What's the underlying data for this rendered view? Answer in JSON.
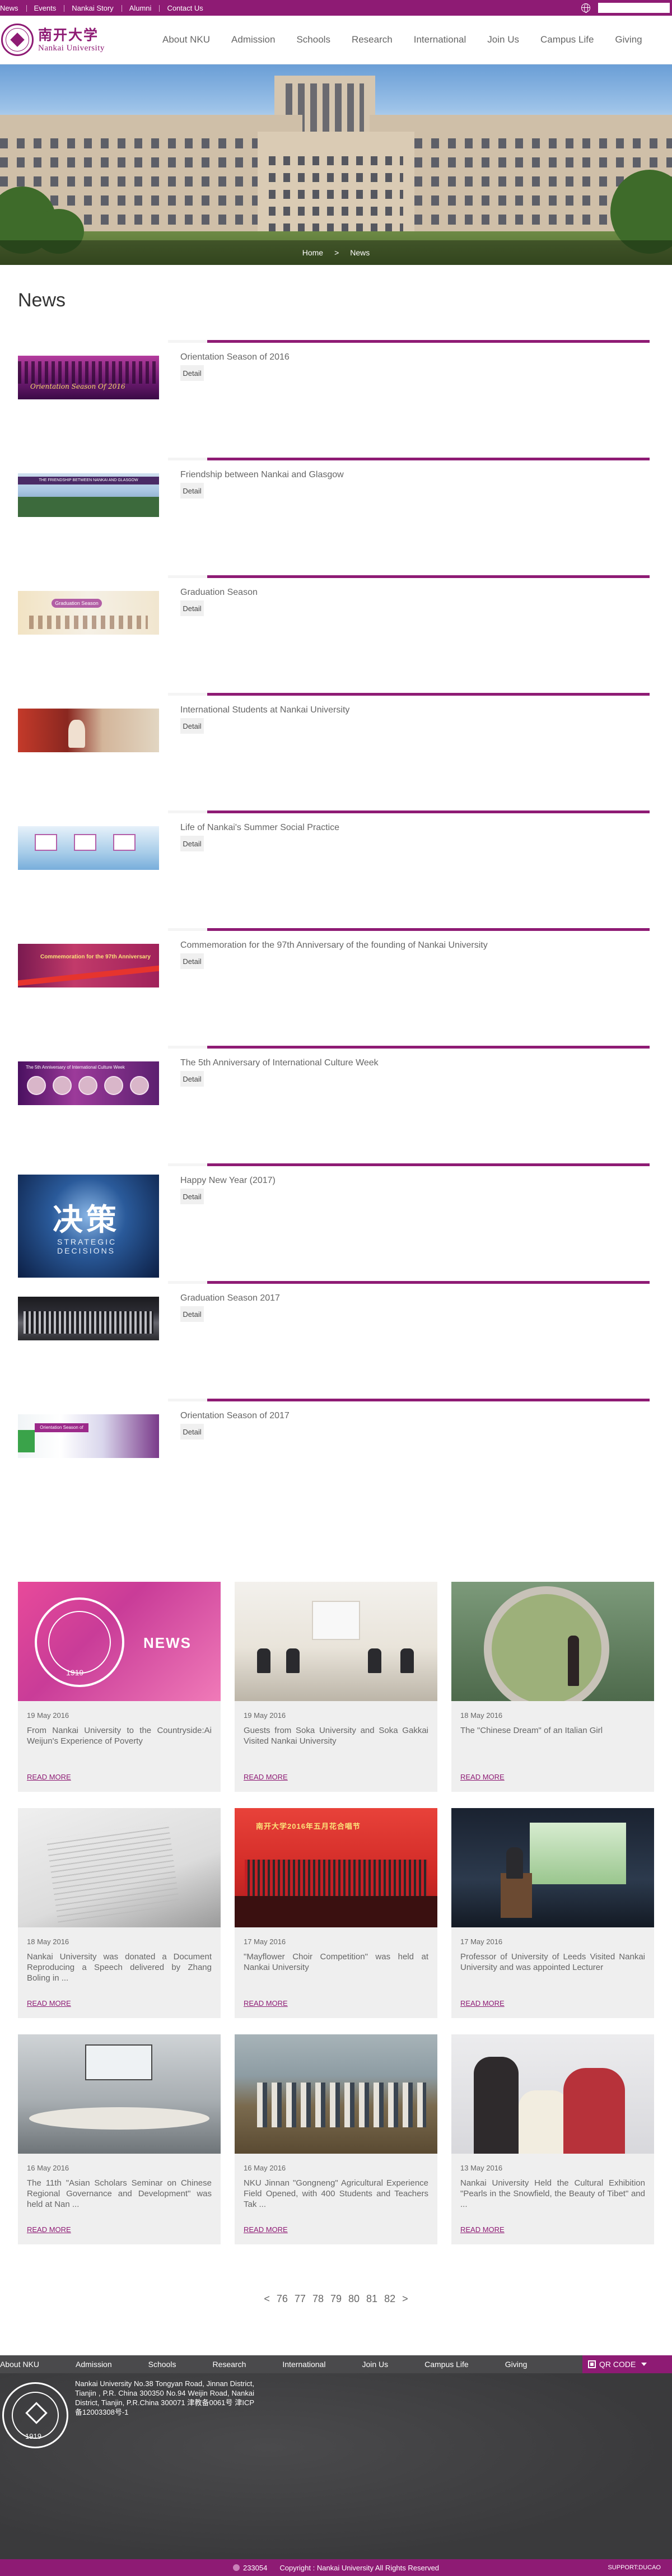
{
  "topbar": {
    "links": [
      "News",
      "Events",
      "Nankai Story",
      "Alumni",
      "Contact Us"
    ],
    "search_placeholder": ""
  },
  "header": {
    "logo_cn": "南开大学",
    "logo_en": "Nankai University",
    "nav": [
      "About NKU",
      "Admission",
      "Schools",
      "Research",
      "International",
      "Join Us",
      "Campus Life",
      "Giving"
    ]
  },
  "breadcrumb": {
    "home": "Home",
    "sep": ">",
    "current": "News"
  },
  "page_title": "News",
  "news_list": [
    {
      "title": "Orientation Season of 2016",
      "detail": "Detail",
      "thumb_text": "Orientation Season Of 2016"
    },
    {
      "title": "Friendship between Nankai and Glasgow",
      "detail": "Detail",
      "thumb_text": "THE FRIENDSHIP BETWEEN NANKAI AND GLASGOW"
    },
    {
      "title": "Graduation Season",
      "detail": "Detail",
      "thumb_text": "Graduation Season"
    },
    {
      "title": "International Students at Nankai University",
      "detail": "Detail"
    },
    {
      "title": "Life of Nankai's Summer Social Practice",
      "detail": "Detail"
    },
    {
      "title": "Commemoration for the 97th Anniversary of the founding of Nankai University",
      "detail": "Detail",
      "thumb_text": "Commemoration for the 97th Anniversary"
    },
    {
      "title": "The 5th Anniversary of International Culture Week",
      "detail": "Detail",
      "thumb_text": "The 5th Anniversary of International Culture Week"
    },
    {
      "title": "Happy New Year (2017)",
      "detail": "Detail",
      "thumb_cn": "决策",
      "thumb_en": "STRATEGIC DECISIONS"
    },
    {
      "title": "Graduation Season 2017",
      "detail": "Detail"
    },
    {
      "title": "Orientation Season of 2017",
      "detail": "Detail",
      "thumb_text": "Orientation Season of 2017"
    }
  ],
  "cards": [
    {
      "date": "19 May 2016",
      "title": "From Nankai University to the Countryside:Ai Weijun's Experience of Poverty",
      "read": "READ MORE",
      "img_word": "NEWS",
      "img_year": "1919"
    },
    {
      "date": "19 May 2016",
      "title": "Guests from Soka University and Soka Gakkai Visited Nankai University",
      "read": "READ MORE"
    },
    {
      "date": "18 May 2016",
      "title": "The \"Chinese Dream\" of an Italian Girl",
      "read": "READ MORE"
    },
    {
      "date": "18 May 2016",
      "title": "Nankai University was donated a Document Reproducing a Speech delivered by Zhang Boling in ...",
      "read": "READ MORE"
    },
    {
      "date": "17 May 2016",
      "title": "\"Mayflower Choir Competition\" was held at Nankai University",
      "read": "READ MORE",
      "img_text": "南开大学2016年五月花合唱节"
    },
    {
      "date": "17 May 2016",
      "title": "Professor of University of Leeds Visited Nankai University and was appointed Lecturer",
      "read": "READ MORE"
    },
    {
      "date": "16 May 2016",
      "title": "The 11th \"Asian Scholars Seminar on Chinese Regional Governance and Development\" was held at Nan ...",
      "read": "READ MORE"
    },
    {
      "date": "16 May 2016",
      "title": "NKU Jinnan \"Gongneng\" Agricultural Experience Field Opened, with 400 Students and Teachers Tak ...",
      "read": "READ MORE"
    },
    {
      "date": "13 May 2016",
      "title": "Nankai University Held the Cultural Exhibition \"Pearls in the Snowfield, the Beauty of Tibet\" and ...",
      "read": "READ MORE"
    }
  ],
  "pagination": {
    "prev": "<",
    "pages": [
      "76",
      "77",
      "78",
      "79",
      "80",
      "81",
      "82"
    ],
    "next": ">"
  },
  "footer": {
    "nav": [
      "About NKU",
      "Admission",
      "Schools",
      "Research",
      "International",
      "Join Us",
      "Campus Life",
      "Giving"
    ],
    "qr_label": "QR CODE",
    "seal_year": "1919",
    "address": "Nankai University No.38 Tongyan Road, Jinnan District, Tianjin , P.R. China 300350 No.94 Weijin Road, Nankai District, Tianjin, P.R.China 300071 津教备0061号 津ICP备12003308号-1",
    "count": "233054",
    "copyright": "Copyright : Nankai University All Rights Reserved",
    "support": "SUPPORT:DUCAO"
  },
  "colors": {
    "brand": "#8e1b74",
    "footer_bg": "#3c3c3e",
    "card_bg": "#efefef"
  }
}
